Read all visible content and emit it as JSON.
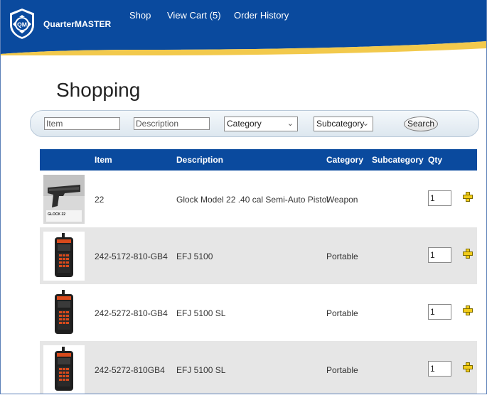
{
  "header": {
    "brand": "QuarterMASTER",
    "logo_text": "QM",
    "nav": [
      "Shop",
      "View Cart (5)",
      "Order History"
    ],
    "colors": {
      "header": "#0a4a9e",
      "accent": "#f2c94c"
    }
  },
  "page": {
    "title": "Shopping"
  },
  "search": {
    "item_placeholder": "Item",
    "description_placeholder": "Description",
    "category_value": "Category",
    "subcategory_value": "Subcategory",
    "button_label": "Search"
  },
  "table": {
    "headers": [
      "Item",
      "Description",
      "Category",
      "Subcategory",
      "Qty"
    ],
    "rows": [
      {
        "item": "22",
        "description": "Glock Model 22 .40 cal Semi-Auto Pistol",
        "category": "Weapon",
        "subcategory": "",
        "qty": "1",
        "thumb": "pistol-image",
        "thumb_caption": "GLOCK 22"
      },
      {
        "item": "242-5172-810-GB4",
        "description": "EFJ 5100",
        "category": "Portable",
        "subcategory": "",
        "qty": "1",
        "thumb": "radio-image"
      },
      {
        "item": "242-5272-810-GB4",
        "description": "EFJ 5100 SL",
        "category": "Portable",
        "subcategory": "",
        "qty": "1",
        "thumb": "radio-image"
      },
      {
        "item": "242-5272-810GB4",
        "description": "EFJ 5100 SL",
        "category": "Portable",
        "subcategory": "",
        "qty": "1",
        "thumb": "radio-image"
      }
    ]
  }
}
